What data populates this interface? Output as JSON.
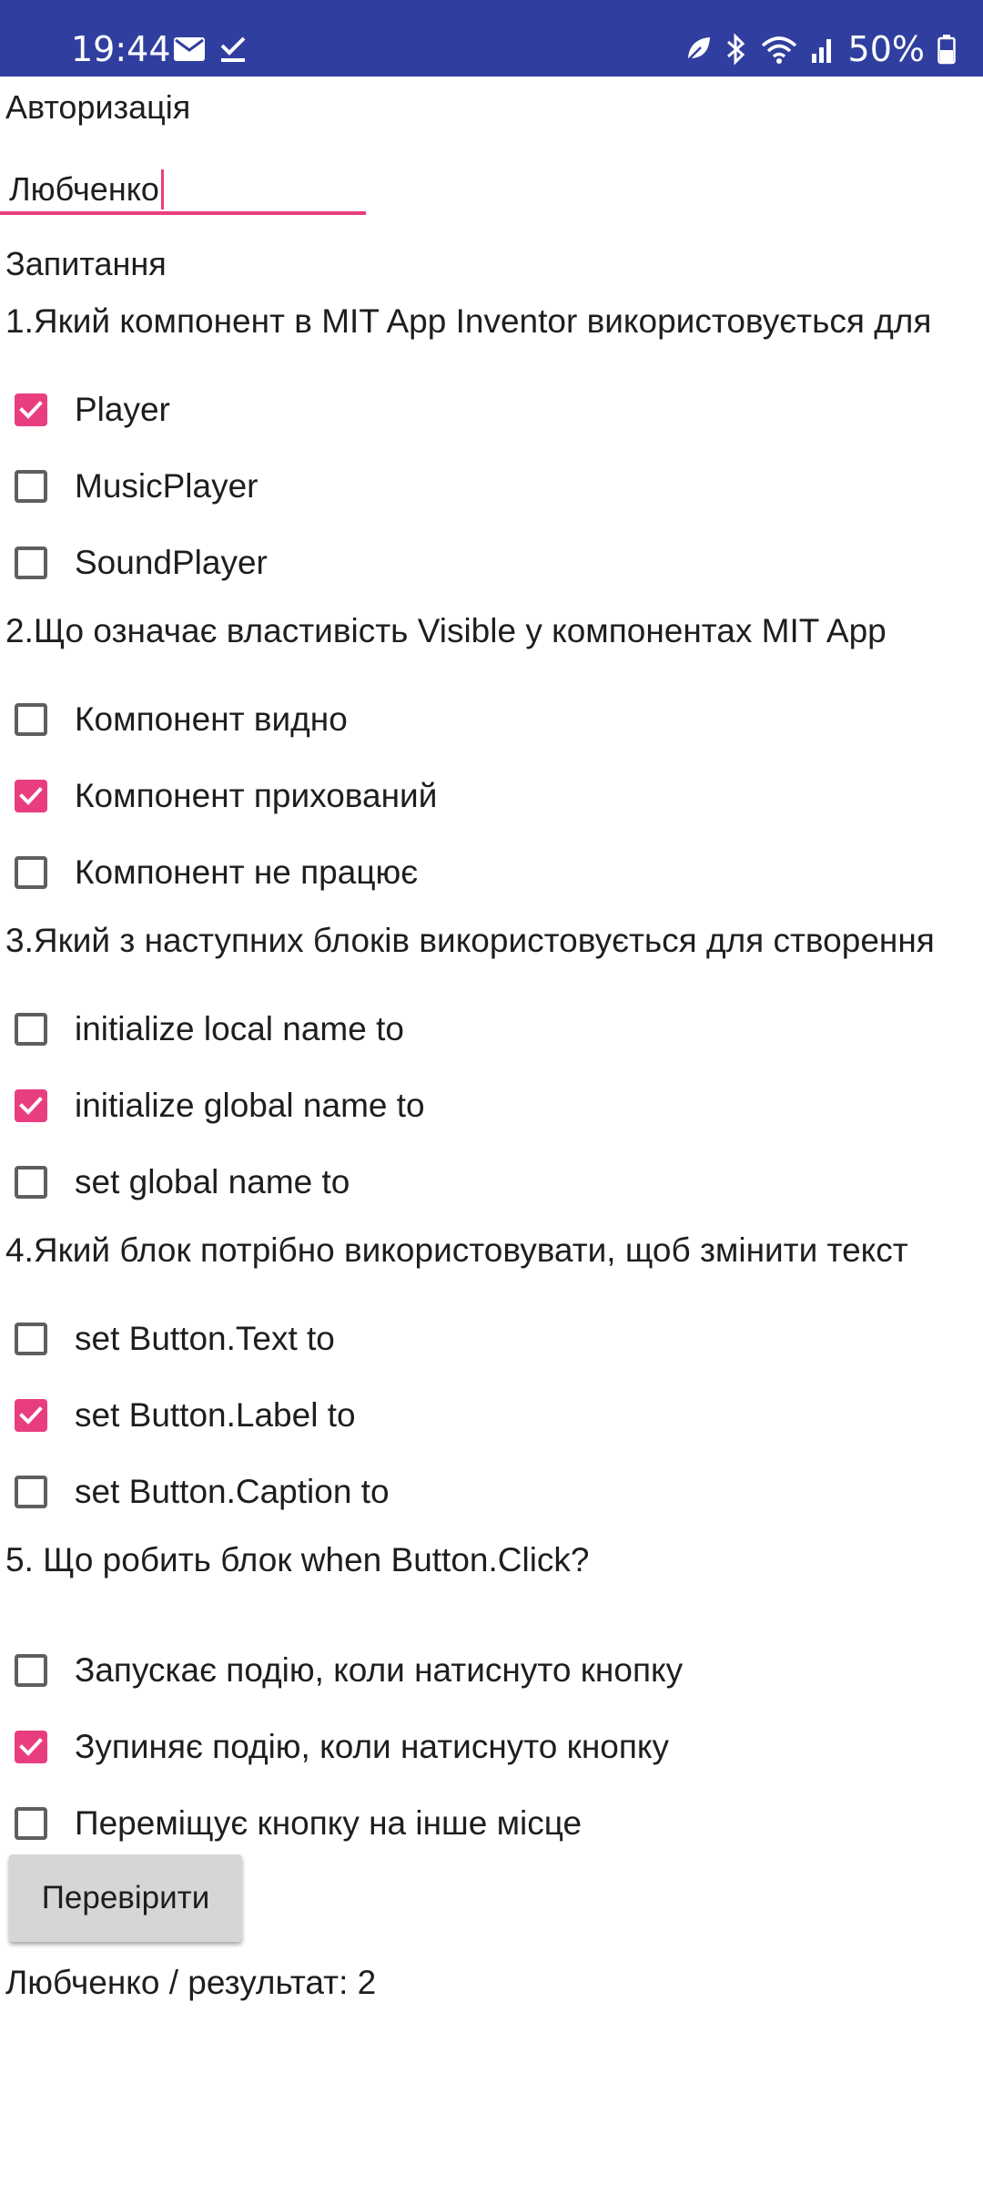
{
  "status_bar": {
    "time": "19:44",
    "battery": "50%",
    "left_icons": [
      "mail-icon",
      "check-icon"
    ],
    "right_icons": [
      "leaf-icon",
      "bluetooth-icon",
      "wifi-icon",
      "signal-icon",
      "battery-icon"
    ],
    "background_color": "#303f9f"
  },
  "auth": {
    "heading": "Авторизація",
    "input_value": "Любченко"
  },
  "questions_heading": "Запитання",
  "questions": [
    {
      "text": "1.Який компонент в MIT App Inventor використовується для відтворення музики?",
      "options": [
        {
          "label": "Player",
          "checked": true
        },
        {
          "label": "MusicPlayer",
          "checked": false
        },
        {
          "label": "SoundPlayer",
          "checked": false
        }
      ]
    },
    {
      "text": "2.Що означає властивість Visible у компонентах MIT App Inventor?",
      "options": [
        {
          "label": "Компонент видно",
          "checked": false
        },
        {
          "label": "Компонент прихований",
          "checked": true
        },
        {
          "label": "Компонент не працює",
          "checked": false
        }
      ]
    },
    {
      "text": "3.Який з наступних блоків використовується для створення глобальної змінної?",
      "options": [
        {
          "label": "initialize local name to",
          "checked": false
        },
        {
          "label": "initialize global name to",
          "checked": true
        },
        {
          "label": "set global name to",
          "checked": false
        }
      ]
    },
    {
      "text": "4.Який блок потрібно використовувати, щоб змінити текст кнопки?",
      "options": [
        {
          "label": "set Button.Text to",
          "checked": false
        },
        {
          "label": "set Button.Label to",
          "checked": true
        },
        {
          "label": "set Button.Caption to",
          "checked": false
        }
      ]
    },
    {
      "text": "5. Що робить блок when Button.Click?",
      "options": [
        {
          "label": "Запускає подію, коли натиснуто кнопку",
          "checked": false
        },
        {
          "label": "Зупиняє подію, коли натиснуто кнопку",
          "checked": true
        },
        {
          "label": "Переміщує кнопку на інше місце",
          "checked": false
        }
      ]
    }
  ],
  "check_button_label": "Перевірити",
  "result_text": "Любченко / результат: 2",
  "accent_color": "#e83e80"
}
